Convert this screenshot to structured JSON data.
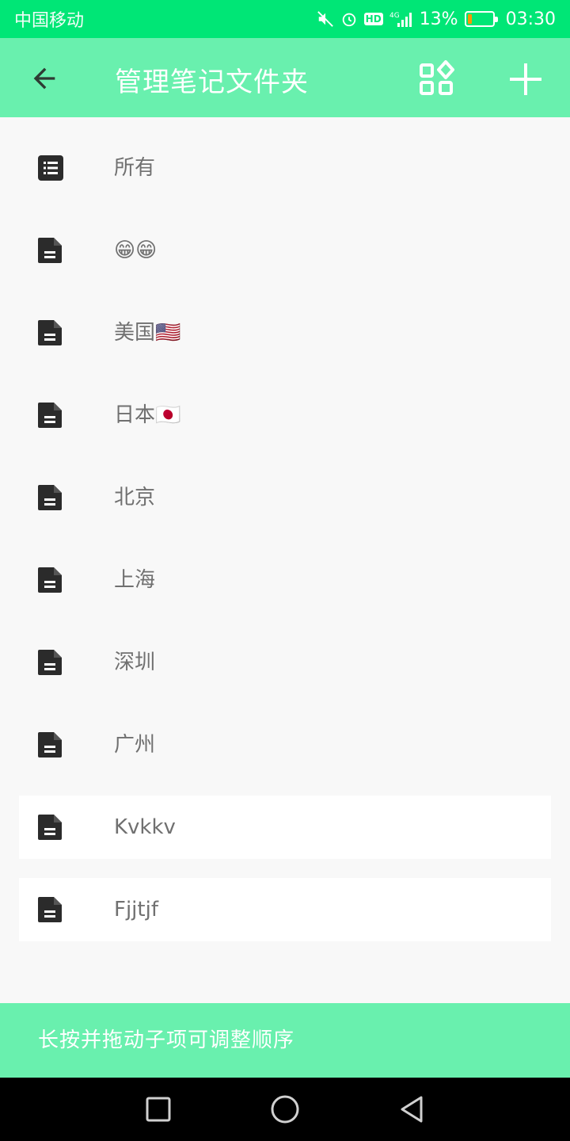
{
  "status_bar": {
    "carrier": "中国移动",
    "network": "4G",
    "hd_label": "HD",
    "battery_percent": "13%",
    "battery_level": 0.13,
    "time": "03:30"
  },
  "app_bar": {
    "title": "管理笔记文件夹",
    "back_icon": "arrow-back-icon",
    "grid_icon": "widgets-icon",
    "add_icon": "plus-icon"
  },
  "folders": [
    {
      "label": "所有",
      "icon": "list-icon"
    },
    {
      "label": "😁😁",
      "icon": "document-icon"
    },
    {
      "label": "美国🇺🇸",
      "icon": "document-icon"
    },
    {
      "label": "日本🇯🇵",
      "icon": "document-icon"
    },
    {
      "label": "北京",
      "icon": "document-icon"
    },
    {
      "label": "上海",
      "icon": "document-icon"
    },
    {
      "label": "深圳",
      "icon": "document-icon"
    },
    {
      "label": "广州",
      "icon": "document-icon"
    },
    {
      "label": "Kvkkv",
      "icon": "document-icon"
    },
    {
      "label": "Fjjtjf",
      "icon": "document-icon"
    }
  ],
  "hint": "长按并拖动子项可调整顺序",
  "colors": {
    "status_bar": "#00e676",
    "app_bar": "#69f0ae",
    "background": "#f8f8f8",
    "icon": "#2b2b2b",
    "label": "#707070"
  }
}
